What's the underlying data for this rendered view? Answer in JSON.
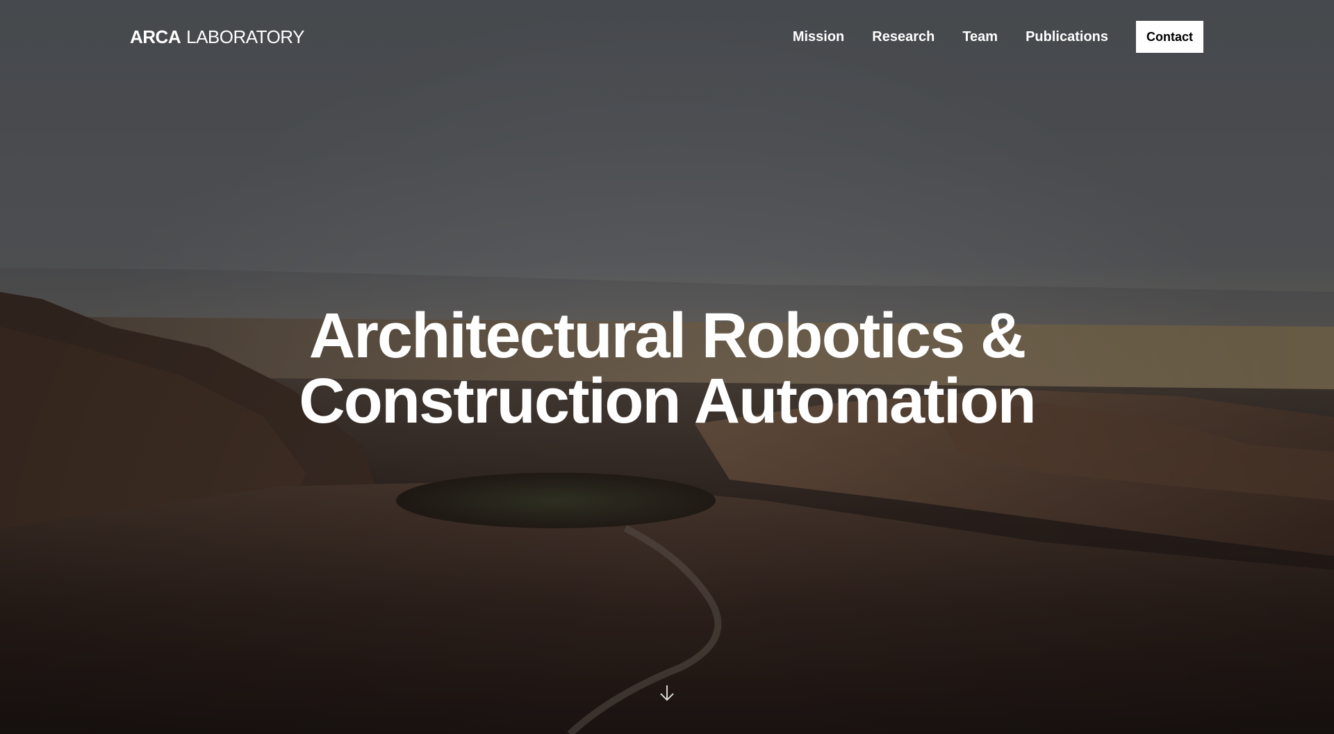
{
  "brand": {
    "name_bold": "ARCA",
    "name_light": "LABORATORY"
  },
  "nav": {
    "items": [
      {
        "label": "Mission"
      },
      {
        "label": "Research"
      },
      {
        "label": "Team"
      },
      {
        "label": "Publications"
      }
    ],
    "contact_label": "Contact"
  },
  "hero": {
    "title_line1": "Architectural Robotics &",
    "title_line2": "Construction Automation",
    "scroll_icon": "arrow-down-icon"
  },
  "colors": {
    "text": "#ffffff",
    "button_bg": "#ffffff",
    "button_text": "#000000"
  }
}
